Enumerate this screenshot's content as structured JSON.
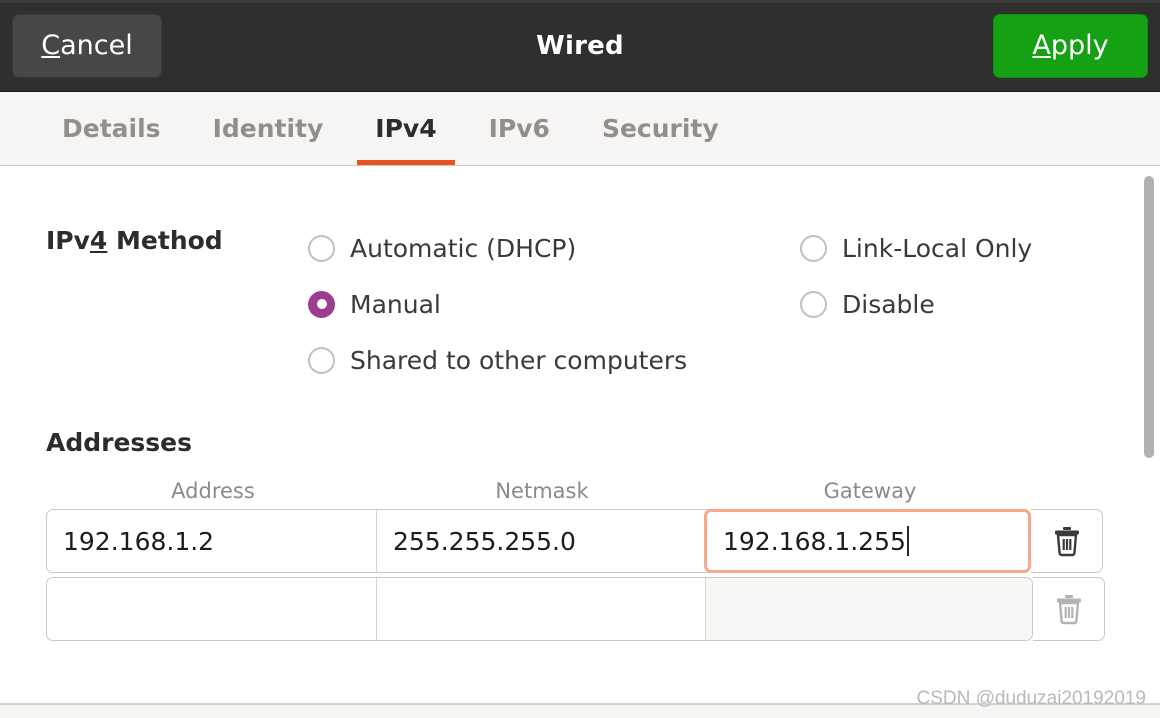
{
  "header": {
    "title": "Wired",
    "cancel_label": "Cancel",
    "cancel_mnemonic": "C",
    "cancel_rest": "ancel",
    "apply_label": "Apply",
    "apply_mnemonic": "A",
    "apply_rest": "pply",
    "apply_color": "#14a214",
    "background": "#2f2f2d"
  },
  "tabs": [
    {
      "label": "Details",
      "active": false
    },
    {
      "label": "Identity",
      "active": false
    },
    {
      "label": "IPv4",
      "active": true
    },
    {
      "label": "IPv6",
      "active": false
    },
    {
      "label": "Security",
      "active": false
    }
  ],
  "tab_accent_color": "#e8521f",
  "method": {
    "label_prefix": "IPv",
    "label_mnemonic": "4",
    "label_suffix": " Method",
    "selected_color": "#9c3d8f",
    "options_left": [
      {
        "label": "Automatic (DHCP)",
        "selected": false
      },
      {
        "label": "Manual",
        "selected": true
      },
      {
        "label": "Shared to other computers",
        "selected": false
      }
    ],
    "options_right": [
      {
        "label": "Link-Local Only",
        "selected": false
      },
      {
        "label": "Disable",
        "selected": false
      }
    ]
  },
  "addresses": {
    "heading": "Addresses",
    "columns": [
      "Address",
      "Netmask",
      "Gateway"
    ],
    "focus_color": "#f6a98b",
    "rows": [
      {
        "address": "192.168.1.2",
        "netmask": "255.255.255.0",
        "gateway": "192.168.1.255",
        "focused_field": "gateway",
        "gateway_disabled": false,
        "delete_enabled": true
      },
      {
        "address": "",
        "netmask": "",
        "gateway": "",
        "focused_field": "",
        "gateway_disabled": true,
        "delete_enabled": false
      }
    ]
  },
  "scrollbar": {
    "thumb_color": "#b3b0ad"
  },
  "watermark": "CSDN @duduzai20192019"
}
